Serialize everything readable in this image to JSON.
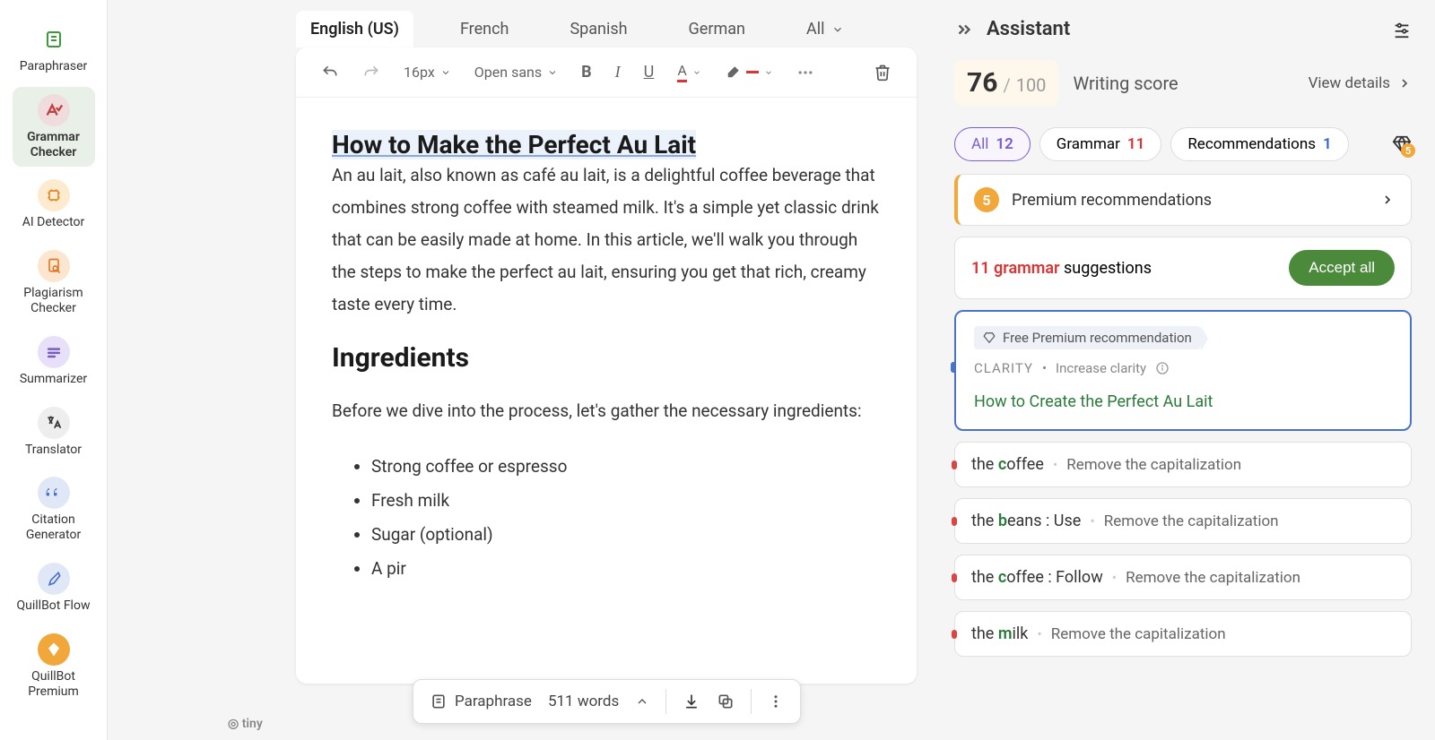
{
  "sidebar": {
    "items": [
      {
        "label": "Paraphraser"
      },
      {
        "label": "Grammar Checker"
      },
      {
        "label": "AI Detector"
      },
      {
        "label": "Plagiarism Checker"
      },
      {
        "label": "Summarizer"
      },
      {
        "label": "Translator"
      },
      {
        "label": "Citation Generator"
      },
      {
        "label": "QuillBot Flow"
      },
      {
        "label": "QuillBot Premium"
      }
    ]
  },
  "tabs": {
    "items": [
      "English (US)",
      "French",
      "Spanish",
      "German",
      "All"
    ],
    "active": "English (US)"
  },
  "toolbar": {
    "font_size": "16px",
    "font_family": "Open sans"
  },
  "document": {
    "title": "How to Make the Perfect Au Lait",
    "intro": "An au lait, also known as café au lait, is a delightful coffee beverage that combines strong coffee with steamed milk. It's a simple yet classic drink that can be easily made at home. In this article, we'll walk you through the steps to make the perfect au lait, ensuring you get that rich, creamy taste every time.",
    "section_title": "Ingredients",
    "section_intro": "Before we dive into the process, let's gather the necessary ingredients:",
    "ingredients": [
      "Strong coffee or espresso",
      "Fresh milk",
      "Sugar (optional)",
      "A pir"
    ]
  },
  "bottom_bar": {
    "paraphrase": "Paraphrase",
    "word_count": "511 words"
  },
  "tiny": "tiny",
  "assistant": {
    "title": "Assistant",
    "score": {
      "value": "76",
      "sep": "/",
      "total": "100",
      "label": "Writing score",
      "details": "View details"
    },
    "filters": {
      "all": {
        "label": "All",
        "count": "12"
      },
      "grammar": {
        "label": "Grammar",
        "count": "11"
      },
      "recommendations": {
        "label": "Recommendations",
        "count": "1"
      },
      "premium_count": "5"
    },
    "premium_card": {
      "count": "5",
      "text": "Premium recommendations"
    },
    "suggestions": {
      "count": "11 grammar",
      "rest": " suggestions",
      "accept": "Accept all"
    },
    "rec_card": {
      "tag": "Free Premium recommendation",
      "category": "CLARITY",
      "hint": "Increase clarity",
      "suggestion": "How to Create the Perfect Au Lait"
    },
    "issues": [
      {
        "pre": "the ",
        "hl": "c",
        "post": "offee",
        "action": "Remove the capitalization"
      },
      {
        "pre": "the ",
        "hl": "b",
        "post": "eans : Use",
        "action": "Remove the capitalization"
      },
      {
        "pre": "the ",
        "hl": "c",
        "post": "offee : Follow",
        "action": "Remove the capitalization"
      },
      {
        "pre": "the ",
        "hl": "m",
        "post": "ilk",
        "action": "Remove the capitalization"
      }
    ]
  }
}
